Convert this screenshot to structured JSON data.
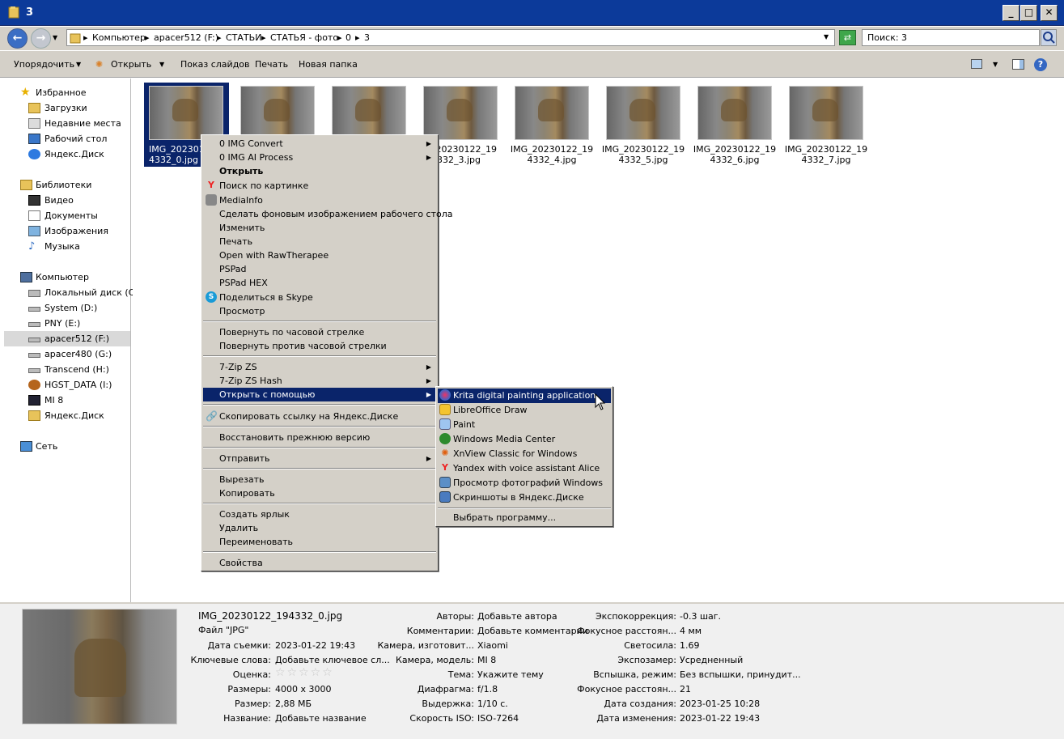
{
  "window": {
    "title": "3"
  },
  "address": {
    "crumbs": [
      "Компьютер",
      "apacer512 (F:)",
      "СТАТЬИ",
      "СТАТЬЯ - фото",
      "0",
      "3"
    ],
    "search_placeholder": "Поиск: 3"
  },
  "toolbar": {
    "organize": "Упорядочить",
    "open": "Открыть",
    "slideshow": "Показ слайдов",
    "print": "Печать",
    "new_folder": "Новая папка"
  },
  "sidebar": {
    "items": [
      {
        "label": "Избранное",
        "icon": "star-icon"
      },
      {
        "label": "Загрузки",
        "icon": "downloads-folder-icon"
      },
      {
        "label": "Недавние места",
        "icon": "recent-places-icon"
      },
      {
        "label": "Рабочий стол",
        "icon": "desktop-icon"
      },
      {
        "label": "Яндекс.Диск",
        "icon": "yandex-disk-icon"
      },
      {
        "label": "Библиотеки",
        "icon": "libraries-icon"
      },
      {
        "label": "Видео",
        "icon": "video-icon"
      },
      {
        "label": "Документы",
        "icon": "documents-icon"
      },
      {
        "label": "Изображения",
        "icon": "pictures-icon"
      },
      {
        "label": "Музыка",
        "icon": "music-icon"
      },
      {
        "label": "Компьютер",
        "icon": "computer-icon"
      },
      {
        "label": "Локальный диск (C:)",
        "icon": "drive-icon"
      },
      {
        "label": "System (D:)",
        "icon": "drive-icon"
      },
      {
        "label": "PNY (E:)",
        "icon": "drive-icon"
      },
      {
        "label": "apacer512 (F:)",
        "icon": "drive-icon"
      },
      {
        "label": "apacer480 (G:)",
        "icon": "drive-icon"
      },
      {
        "label": "Transcend (H:)",
        "icon": "drive-icon"
      },
      {
        "label": "HGST_DATA (I:)",
        "icon": "hgst-drive-icon"
      },
      {
        "label": "MI 8",
        "icon": "phone-icon"
      },
      {
        "label": "Яндекс.Диск",
        "icon": "yandex-disk-icon"
      },
      {
        "label": "Сеть",
        "icon": "network-icon"
      }
    ]
  },
  "files": [
    {
      "l1": "IMG_2023012",
      "l2": "4332_0.jpg"
    },
    {
      "l1": "",
      "l2": ""
    },
    {
      "l1": "",
      "l2": ""
    },
    {
      "l1": "_20230122_19",
      "l2": "4332_3.jpg"
    },
    {
      "l1": "IMG_20230122_19",
      "l2": "4332_4.jpg"
    },
    {
      "l1": "IMG_20230122_19",
      "l2": "4332_5.jpg"
    },
    {
      "l1": "IMG_20230122_19",
      "l2": "4332_6.jpg"
    },
    {
      "l1": "IMG_20230122_19",
      "l2": "4332_7.jpg"
    }
  ],
  "context_menu": {
    "items": [
      "0 IMG Convert",
      "0 IMG AI Process",
      "Открыть",
      "Поиск по картинке",
      "MediaInfo",
      "Сделать фоновым изображением рабочего стола",
      "Изменить",
      "Печать",
      "Open with RawTherapee",
      "PSPad",
      "PSPad HEX",
      "Поделиться в Skype",
      "Просмотр",
      "Повернуть по часовой стрелке",
      "Повернуть против часовой стрелки",
      "7-Zip ZS",
      "7-Zip ZS Hash",
      "Открыть с помощью",
      "Скопировать ссылку на Яндекс.Диске",
      "Восстановить прежнюю версию",
      "Отправить",
      "Вырезать",
      "Копировать",
      "Создать ярлык",
      "Удалить",
      "Переименовать",
      "Свойства"
    ]
  },
  "open_with": {
    "items": [
      "Krita digital painting application",
      "LibreOffice Draw",
      "Paint",
      "Windows Media Center",
      "XnView Classic for Windows",
      "Yandex with voice assistant Alice",
      "Просмотр фотографий Windows",
      "Скриншоты в Яндекс.Диске",
      "Выбрать программу..."
    ]
  },
  "details": {
    "filename": "IMG_20230122_194332_0.jpg",
    "filetype": "Файл \"JPG\"",
    "col1": [
      [
        "Дата съемки:",
        "2023-01-22 19:43"
      ],
      [
        "Ключевые слова:",
        "Добавьте ключевое сл..."
      ],
      [
        "Оценка:",
        ""
      ],
      [
        "Размеры:",
        "4000 x 3000"
      ],
      [
        "Размер:",
        "2,88 МБ"
      ],
      [
        "Название:",
        "Добавьте название"
      ]
    ],
    "col2": [
      [
        "Авторы:",
        "Добавьте автора"
      ],
      [
        "Комментарии:",
        "Добавьте комментарии"
      ],
      [
        "Камера, изготовит...",
        "Xiaomi"
      ],
      [
        "Камера, модель:",
        "MI 8"
      ],
      [
        "Тема:",
        "Укажите тему"
      ],
      [
        "Диафрагма:",
        "f/1.8"
      ],
      [
        "Выдержка:",
        "1/10 с."
      ],
      [
        "Скорость ISO:",
        "ISO-7264"
      ]
    ],
    "col3": [
      [
        "Экспокоррекция:",
        "-0.3 шаг."
      ],
      [
        "Фокусное расстоян...",
        "4 мм"
      ],
      [
        "Светосила:",
        "1.69"
      ],
      [
        "Экспозамер:",
        "Усредненный"
      ],
      [
        "Вспышка, режим:",
        "Без вспышки, принудит..."
      ],
      [
        "Фокусное расстоян...",
        "21"
      ],
      [
        "Дата создания:",
        "2023-01-25 10:28"
      ],
      [
        "Дата изменения:",
        "2023-01-22 19:43"
      ]
    ]
  }
}
